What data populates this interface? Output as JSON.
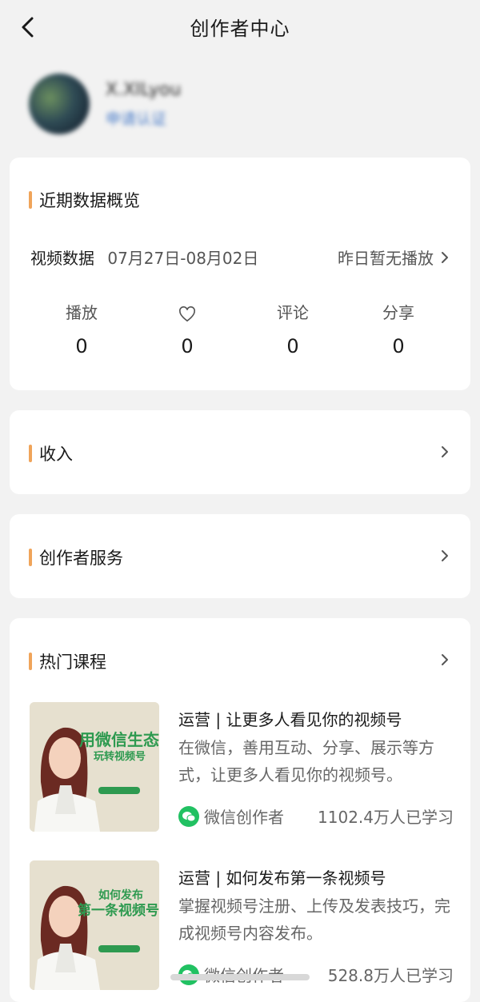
{
  "header": {
    "title": "创作者中心"
  },
  "profile": {
    "name": "X.XILyou",
    "auth_link": "申请认证"
  },
  "overview": {
    "title": "近期数据概览",
    "video_label": "视频数据",
    "date_range": "07月27日-08月02日",
    "status_link": "昨日暂无播放",
    "stats": [
      {
        "label": "播放",
        "value": "0"
      },
      {
        "label": "",
        "icon": "heart-icon",
        "value": "0"
      },
      {
        "label": "评论",
        "value": "0"
      },
      {
        "label": "分享",
        "value": "0"
      }
    ]
  },
  "income": {
    "title": "收入"
  },
  "service": {
    "title": "创作者服务"
  },
  "courses": {
    "title": "热门课程",
    "items": [
      {
        "title": "运营 | 让更多人看见你的视频号",
        "desc": "在微信，善用互动、分享、展示等方式，让更多人看见你的视频号。",
        "author": "微信创作者",
        "learners": "1102.4万人已学习",
        "thumb_line1": "用微信生态",
        "thumb_line2": "玩转视频号"
      },
      {
        "title": "运营 | 如何发布第一条视频号",
        "desc": "掌握视频号注册、上传及发表技巧，完成视频号内容发布。",
        "author": "微信创作者",
        "learners": "528.8万人已学习",
        "thumb_line1": "如何发布",
        "thumb_line2": "第一条视频号"
      }
    ]
  },
  "colors": {
    "accent_bar": "#f0a45a",
    "wechat_green": "#21c162",
    "thumb_green": "#2e9a50"
  }
}
